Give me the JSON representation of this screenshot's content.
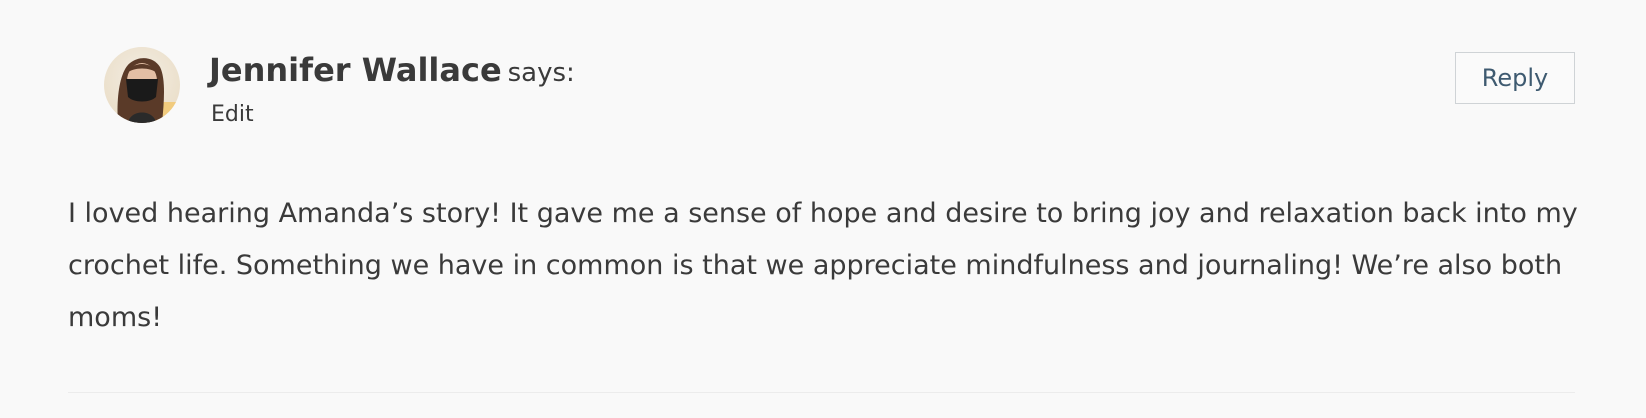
{
  "comment": {
    "author": "Jennifer Wallace",
    "says": "says:",
    "edit_label": "Edit",
    "reply_label": "Reply",
    "body": "I loved hearing Amanda’s story! It gave me a sense of hope and desire to bring joy and relaxation back into my crochet life. Something we have in common is that we appreciate mindfulness and journaling! We’re also both moms!"
  },
  "colors": {
    "background": "#f9f9f9",
    "text": "#3a3a3a",
    "reply_text": "#3e5a70",
    "reply_border": "#cfd3d6"
  },
  "icons": {
    "avatar": "user-avatar-photo"
  }
}
